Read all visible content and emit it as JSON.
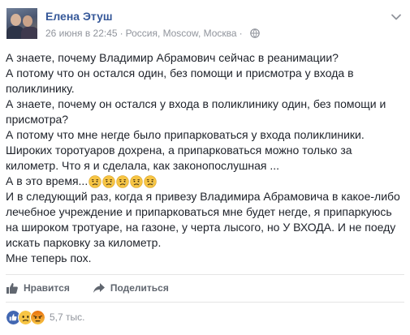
{
  "post": {
    "author": "Елена Этуш",
    "date": "26 июня в 22:45",
    "separator": "·",
    "location": "Россия, Moscow, Москва",
    "lines": [
      "А знаете, почему Владимир Абрамович сейчас в реанимации?",
      "А потому что он остался один, без помощи и присмотра у входа в",
      "поликлинику.",
      "А знаете, почему он остался у входа в поликлинику один, без помощи и",
      "присмотра?",
      "А потому что мне негде было припарковаться у входа поликлиники.",
      "Широких торотуаров дохрена, а припарковаться можно только за",
      "километр. Что я и сделала, как законопослушная ...",
      "А в это время...",
      "И в следующий раз, когда я привезу Владимира Абрамовича в какое-либо",
      "лечебное учреждение и припарковаться мне будет негде, я припаркуюсь",
      "на широком тротуаре, на газоне, у черта лысого, но У ВХОДА. И не поеду",
      "искать парковку за километр.",
      "Мне теперь пох."
    ],
    "sad_emoji_count": 5,
    "sad_emoji_icon": "sad-face-emoji"
  },
  "actions": {
    "like_label": "Нравится",
    "like_icon": "thumbs-up-icon",
    "share_label": "Поделиться",
    "share_icon": "share-arrow-icon"
  },
  "reactions": {
    "icons": [
      "like-reaction-icon",
      "sad-reaction-icon",
      "angry-reaction-icon"
    ],
    "count": "5,7 тыс."
  },
  "colors": {
    "author_link": "#365899",
    "meta_text": "#90949c",
    "like_blue": "#4267b2",
    "emoji_yellow": "#f7c544",
    "angry_red": "#e9710f"
  }
}
